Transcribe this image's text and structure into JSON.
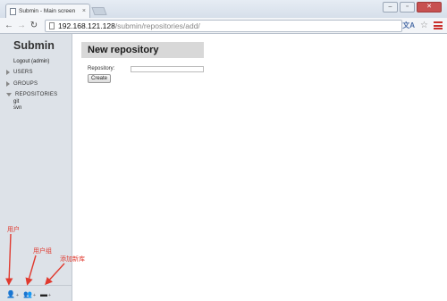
{
  "browser": {
    "tab_title": "Submin - Main screen",
    "url_host": "192.168.121.128",
    "url_path": "/submin/repositories/add/"
  },
  "sidebar": {
    "title": "Submin",
    "logout": "Logout (admin)",
    "nav": [
      {
        "label": "USERS",
        "expanded": false
      },
      {
        "label": "GROUPS",
        "expanded": false
      },
      {
        "label": "REPOSITORIES",
        "expanded": true
      }
    ],
    "repositories": [
      "git",
      "svn"
    ],
    "bottom_icons": [
      "add-user-icon",
      "add-group-icon",
      "add-repository-icon"
    ]
  },
  "annotations": {
    "user": "用户",
    "group": "用户组",
    "repo": "添加新库",
    "color": "#e03a2f"
  },
  "form": {
    "title": "New repository",
    "repository_label": "Repository:",
    "repository_value": "",
    "create_label": "Create"
  },
  "colors": {
    "sidebar_bg": "#dde2e8",
    "title_bar": "#d8d8d8",
    "accent_red": "#c9302c"
  }
}
